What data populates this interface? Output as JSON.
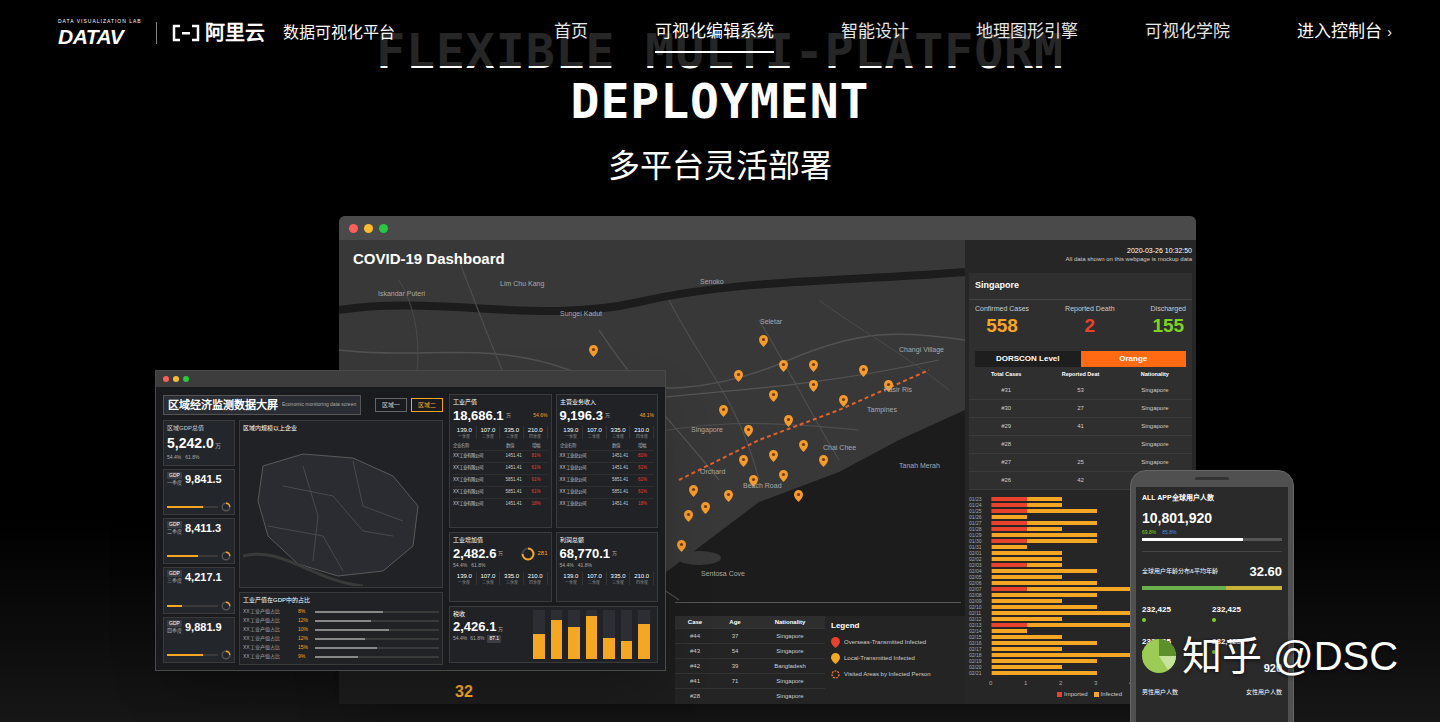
{
  "nav": {
    "lab": "DATA VISUALIZATION LAB",
    "brand": "DATAV",
    "cloud": "阿里云",
    "platform": "数据可视化平台",
    "items": [
      {
        "label": "首页",
        "selected": false
      },
      {
        "label": "可视化编辑系统",
        "selected": true
      },
      {
        "label": "智能设计",
        "selected": false
      },
      {
        "label": "地理图形引擎",
        "selected": false
      },
      {
        "label": "可视化学院",
        "selected": false
      }
    ],
    "console": "进入控制台",
    "console_arrow": "›"
  },
  "hero": {
    "line1": "FLEXIBLE MULTI-PLATFORM",
    "line2": "DEPLOYMENT",
    "subtitle": "多平台灵活部署"
  },
  "covid": {
    "title": "COVID-19 Dashboard",
    "time": "2020-03-26 10:32:50",
    "note": "All data shown on this webpage is mockup data",
    "map_labels": [
      "Iskandar Puteri",
      "Lim Chu Kang",
      "Sungei Kadut",
      "Senoko",
      "Seletar",
      "Changi Village",
      "Pasir Ris",
      "Tampines",
      "Singapore",
      "Chai Chee",
      "Tanah Merah",
      "Orchard",
      "Beach Road",
      "Sentosa Cove"
    ],
    "corner_value": "32",
    "region": "Singapore",
    "stats": [
      {
        "label": "Confirmed Cases",
        "value": "558",
        "color": "#f5a623"
      },
      {
        "label": "Reported Death",
        "value": "2",
        "color": "#e8412c"
      },
      {
        "label": "Discharged",
        "value": "155",
        "color": "#7ed321"
      }
    ],
    "dorscon": {
      "label": "DORSCON Level",
      "value": "Orange"
    },
    "cases_table": {
      "columns": [
        "Total Cases",
        "Reported Deat",
        "Nationality"
      ],
      "rows": [
        [
          "#31",
          "53",
          "Singapore"
        ],
        [
          "#30",
          "27",
          "Singapore"
        ],
        [
          "#29",
          "41",
          "Singapore"
        ],
        [
          "#28",
          "",
          "Singapore"
        ],
        [
          "#27",
          "25",
          "Singapore"
        ],
        [
          "#26",
          "42"
        ]
      ]
    },
    "chart": {
      "dates": [
        "01/23",
        "01/24",
        "01/25",
        "01/26",
        "01/27",
        "01/28",
        "01/29",
        "01/30",
        "01/31",
        "02/01",
        "02/02",
        "02/03",
        "02/04",
        "02/05",
        "02/06",
        "02/07",
        "02/08",
        "02/09",
        "02/10",
        "02/11",
        "02/12",
        "02/13",
        "02/14",
        "02/15",
        "02/16",
        "02/17",
        "02/18",
        "02/19",
        "02/20",
        "02/21"
      ],
      "series": [
        {
          "name": "Imported",
          "color": "#e8412c",
          "values": [
            1,
            1,
            1,
            0,
            1,
            1,
            0,
            1,
            0,
            0,
            0,
            1,
            0,
            0,
            0,
            1,
            0,
            0,
            0,
            0,
            0,
            1,
            0,
            0,
            0,
            0,
            0,
            0,
            0,
            0
          ]
        },
        {
          "name": "Infected",
          "color": "#f5a623",
          "values": [
            1,
            1,
            2,
            1,
            2,
            1,
            3,
            2,
            1,
            2,
            2,
            1,
            3,
            2,
            3,
            4,
            3,
            2,
            3,
            4,
            2,
            3,
            1,
            2,
            3,
            2,
            4,
            3,
            2,
            3
          ]
        }
      ],
      "ticks": [
        "0",
        "1",
        "2",
        "3",
        "4"
      ]
    },
    "case_list": {
      "columns": [
        "Case",
        "Age",
        "Nationality"
      ],
      "rows": [
        [
          "#44",
          "37",
          "Singapore"
        ],
        [
          "#43",
          "54",
          "Singapore"
        ],
        [
          "#42",
          "39",
          "Bangladesh"
        ],
        [
          "#41",
          "71",
          "Singapore"
        ],
        [
          "#28",
          "",
          "Singapore"
        ]
      ]
    },
    "legend": {
      "title": "Legend",
      "items": [
        {
          "label": "Overseas-Transmitted Infected",
          "color": "#e8412c"
        },
        {
          "label": "Local-Transmitted Infected",
          "color": "#f5a623"
        },
        {
          "label": "Visited Areas by Infected Person",
          "color": "#ff7a2a"
        }
      ]
    }
  },
  "economy": {
    "title": "区域经济监测数据大屏",
    "subtitle": "Economic monitoring data screen",
    "tabs": [
      {
        "label": "区域一",
        "selected": false
      },
      {
        "label": "区域二",
        "selected": true
      }
    ],
    "gdp_total": {
      "label": "区域GDP总值",
      "value": "5,242.0",
      "unit": "万",
      "rates": [
        "54.4%",
        "61.8%"
      ]
    },
    "quarters": [
      {
        "tag": "GDP",
        "label": "一季度",
        "value": "9,841.5",
        "level": 0.7
      },
      {
        "tag": "GDP",
        "label": "二季度",
        "value": "8,411.3",
        "level": 0.6
      },
      {
        "tag": "GDP",
        "label": "三季度",
        "value": "4,217.1",
        "level": 0.3
      },
      {
        "tag": "GDP",
        "label": "四季度",
        "value": "9,881.9",
        "level": 0.7
      }
    ],
    "map_title": "区域内规模以上企业",
    "share_title": "工业产值在GDP中的占比",
    "share_rows": [
      {
        "label": "XX工业产值占比",
        "pct": "8%",
        "level": 0.55
      },
      {
        "label": "XX工业产值占比",
        "pct": "12%",
        "level": 0.45
      },
      {
        "label": "XX工业产值占比",
        "pct": "10%",
        "level": 0.6
      },
      {
        "label": "XX工业产值占比",
        "pct": "12%",
        "level": 0.4
      },
      {
        "label": "XX工业产值占比",
        "pct": "15%",
        "level": 0.5
      },
      {
        "label": "XX工业产值占比",
        "pct": "9%",
        "level": 0.35
      }
    ],
    "sub_labels": [
      "一季度",
      "二季度",
      "三季度",
      "四季度"
    ],
    "table_columns": [
      "企业名称",
      "数值",
      "增幅"
    ],
    "cards": [
      {
        "kind": "table",
        "title": "工业产值",
        "value": "18,686.1",
        "unit": "万",
        "badge": "54.6%",
        "subs": [
          "139.0",
          "107.0",
          "335.0",
          "210.0"
        ],
        "rows": [
          [
            "XX工业有限公司",
            "1451.41",
            "81%"
          ],
          [
            "XX工业有限公司",
            "1451.41",
            "61%"
          ],
          [
            "XX工业有限公司",
            "5851.41",
            "61%"
          ],
          [
            "XX工业有限公司",
            "5851.41",
            "61%"
          ],
          [
            "XX工业有限公司",
            "1451.41",
            "18%"
          ]
        ]
      },
      {
        "kind": "table",
        "title": "主营业务收入",
        "value": "9,196.3",
        "unit": "万",
        "badge": "48.1%",
        "subs": [
          "139.0",
          "107.0",
          "335.0",
          "210.0"
        ],
        "rows": [
          [
            "XX工业总公司",
            "1451.41",
            "81%"
          ],
          [
            "XX工业总公司",
            "1451.41",
            "61%"
          ],
          [
            "XX工业总公司",
            "5851.41",
            "61%"
          ],
          [
            "XX工业总公司",
            "5851.41",
            "61%"
          ],
          [
            "XX工业总公司",
            "1451.41",
            "18%"
          ]
        ]
      },
      {
        "kind": "gauge",
        "title": "工业增加值",
        "value": "2,482.6",
        "unit": "万",
        "badge": "281",
        "rates": [
          "54.4%",
          "61.8%"
        ],
        "subs": [
          "139.0",
          "107.0",
          "335.0",
          "210.0"
        ]
      },
      {
        "kind": "summary",
        "title": "利润总额",
        "value": "68,770.1",
        "unit": "万",
        "rates": [
          "54.4%",
          "41.8%"
        ],
        "subs": [
          "139.0",
          "107.0",
          "335.0",
          "210.0"
        ]
      }
    ],
    "tax": {
      "title": "税收",
      "value": "2,426.1",
      "unit": "万",
      "rates": [
        "54.4%",
        "61.8%"
      ],
      "extra": "87.1",
      "bars": [
        35,
        55,
        45,
        60,
        30,
        25,
        50
      ]
    }
  },
  "phone": {
    "title": "ALL APP全球用户人数",
    "value": "10,801,920",
    "rates": [
      "69.8%",
      "85.8%"
    ],
    "progress": 0.72,
    "age_title": "全球用户年龄分布&平均年龄",
    "age_value": "32.60",
    "age_level": 0.6,
    "counts": [
      "232,425",
      "232,425",
      "232,425",
      "232,425"
    ],
    "partial": "920",
    "genders": [
      "男性用户人数",
      "女性用户人数"
    ]
  },
  "watermark": {
    "text": "知乎 @DSC"
  }
}
